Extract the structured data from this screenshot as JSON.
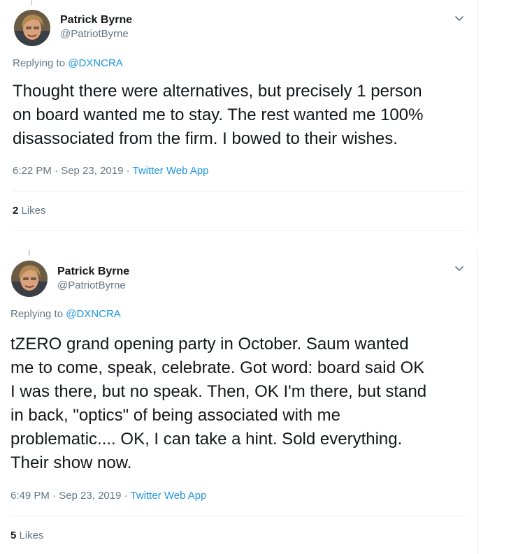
{
  "tweets": [
    {
      "display_name": "Patrick Byrne",
      "handle": "@PatriotByrne",
      "replying_prefix": "Replying to ",
      "replying_to": "@DXNCRA",
      "text": "Thought there were alternatives, but precisely 1 person\non board wanted me to stay. The rest wanted me 100%\ndisassociated from the firm.  I bowed to their wishes.",
      "time_date": "6:22 PM · Sep 23, 2019 · ",
      "source": "Twitter Web App",
      "likes_count": "2",
      "likes_label": " Likes",
      "avatar_icon": "profile-photo",
      "menu_icon": "chevron-down-icon"
    },
    {
      "display_name": "Patrick Byrne",
      "handle": "@PatriotByrne",
      "replying_prefix": "Replying to ",
      "replying_to": "@DXNCRA",
      "text": "tZERO grand opening party in October. Saum wanted\nme to come, speak, celebrate. Got word: board said OK\nI was there, but no speak. Then, OK I'm there, but stand\nin back,  \"optics\" of being associated with me\nproblematic.... OK, I can take a hint. Sold everything.\nTheir show now.",
      "time_date": "6:49 PM · Sep 23, 2019 · ",
      "source": "Twitter Web App",
      "likes_count": "5",
      "likes_label": " Likes",
      "avatar_icon": "profile-photo",
      "menu_icon": "chevron-down-icon"
    }
  ],
  "colors": {
    "text": "#14171a",
    "secondary": "#657786",
    "link": "#1b95e0",
    "border": "#e6ecf0"
  }
}
